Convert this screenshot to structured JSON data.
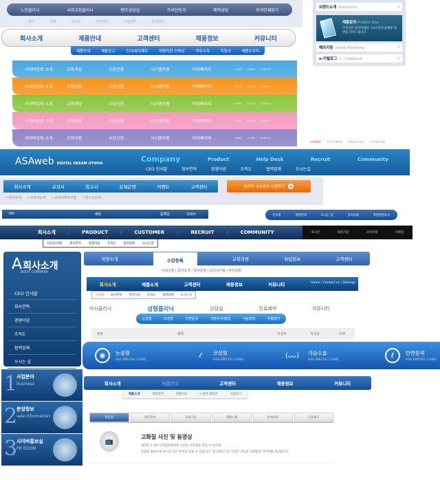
{
  "s1": {
    "top_nav": [
      "노인클리닉",
      "사회교정클리닉",
      "펜즈상담실",
      "프리던인과",
      "예약상담",
      "프리인재찾기"
    ],
    "sub_nav": [
      "회사",
      "위해",
      "파티재",
      "재미리시",
      "드림센터",
      "문제센터"
    ]
  },
  "right_box": {
    "brand": "브랜드소개",
    "brand_en": "Brand Intro",
    "qna": "제품문의",
    "qna_en": "Product Qna",
    "qna_text": "무엇이든 문의하세요. 24시간이내 빠른 답변을 약속드립니다.",
    "global": "해외지점",
    "global_en": "Global Marketing",
    "catalog": "e-카탈로그",
    "catalog_en": "e - Catalogue",
    "arrow": "›"
  },
  "s2": {
    "tabs": [
      "회사소개",
      "제품안내",
      "고객센터",
      "채용정보",
      "커뮤니티"
    ],
    "sub": [
      "제품안내",
      "채용공고",
      "인사/복지제도",
      "바람직한 인재상",
      "직무소개",
      "지원서",
      "채용도우미"
    ]
  },
  "color_bars": {
    "items": [
      "사이버강좌 소개",
      "교육과정",
      "수강신청",
      "시스템지원",
      "마이페이지"
    ],
    "small": [
      "HOME",
      "LOGIN",
      "SITEMAP"
    ],
    "colors": [
      "#4aa8e0",
      "#f7941d",
      "#8cc63f",
      "#f49ac1",
      "#8e86c9"
    ]
  },
  "langs": [
    "HOME",
    "SITEMAP",
    "ENGLISH",
    "CHINESE"
  ],
  "asaweb": {
    "logo": "ASAweb",
    "tagline": "DIGITAL DREAM UTOPIA",
    "main": [
      "Company",
      "Product",
      "Help Desk",
      "Recruit",
      "Community"
    ],
    "sub": [
      "CEO 인사말",
      "회사연혁",
      "경영이념",
      "조직도",
      "협력업체",
      "오시는길"
    ]
  },
  "panel": {
    "tabs": [
      "회사소개",
      "교과서",
      "참고서",
      "문제은행",
      "이벤트",
      "고객센터"
    ],
    "sub": [
      "• 회사소개",
      "• 교과서소개",
      "• 교과서제작과정",
      "• 연구소안내"
    ],
    "button": "온라인 수능강좌 신청하기"
  },
  "table1": {
    "headers": [
      "NO",
      "제목",
      "등록일",
      "조회수"
    ]
  },
  "pill1": [
    "인사말",
    "학원연혁",
    "오시는 길",
    "공지사항",
    "학원관련뉴스"
  ],
  "dark_bar": {
    "items": [
      "회사소개",
      "PRODUCT",
      "CUSTOMER",
      "RECRUIT",
      "COMMUNITY"
    ],
    "sep": "/",
    "util": [
      "로그인",
      "회원가입",
      "사이트맵",
      "이메일"
    ],
    "sub": [
      "CEO인사말",
      "회사연혁",
      "경영이념",
      "조직도",
      "협력업체",
      "오시는길"
    ]
  },
  "sidebar": {
    "title": "회사소개",
    "letter": "A",
    "subtitle": "BOUT COMPANY",
    "items": [
      "CEO 인사말",
      "회사연혁",
      "경영이념",
      "조직도",
      "협력업체",
      "오시는 길"
    ]
  },
  "tabs2": {
    "items": [
      "학원소개",
      "수강등록",
      "교육과정",
      "취업정보",
      "고객센터"
    ],
    "sub": "수강신청 | 강사소개 | 학사일정 | 강의시간표 | 추천강좌"
  },
  "bar3": {
    "items": [
      "회사소개",
      "제품소개",
      "고객센터",
      "채용정보",
      "커뮤니티"
    ],
    "links": "Home / Contact us / Sitemap",
    "sub": [
      "인사말",
      "회사연혁",
      "경영이념",
      "조직도",
      "협력업체",
      "오시는길"
    ]
  },
  "clinic": {
    "items": [
      "아사클리닉",
      "성형클리닉",
      "상담실",
      "진료예약",
      "커뮤니티"
    ],
    "pill": [
      "눈성형",
      "코성형",
      "안면윤곽",
      "지방이식/흡입",
      "가슴성형",
      "주름제거"
    ]
  },
  "table2": {
    "headers": [
      "번호",
      "제목",
      "작성자",
      "작성일",
      "조회"
    ]
  },
  "clinic_bar": {
    "items": [
      {
        "name": "눈성형",
        "sub": "ASA SPECIAL CLINIC"
      },
      {
        "name": "코성형",
        "sub": "ASA SPECIAL CLINIC"
      },
      {
        "name": "가슴수술",
        "sub": "ASA SPECIAL CLINIC"
      },
      {
        "name": "안면윤곽",
        "sub": "ASA SPECIAL CLINIC"
      }
    ]
  },
  "left_blocks": [
    {
      "num": "1",
      "title": "사업분야",
      "en": "business"
    },
    {
      "num": "2",
      "title": "분양정보",
      "en": "sale information"
    },
    {
      "num": "3",
      "title": "사이버홍보실",
      "en": "PR ROOM"
    }
  ],
  "nav4": {
    "items": [
      "회사소개",
      "제품안내",
      "고객센터",
      "채용정보",
      "커뮤니티"
    ],
    "sub": [
      "제품소개",
      "제품정책",
      "제품비교",
      "e-컴퍼 체험관",
      "사용후기"
    ]
  },
  "product_tabs": [
    "특장점",
    "세부정보",
    "주요기능",
    "제품스펙",
    "악세사리",
    "다운로드"
  ],
  "feature": {
    "title": "고화질 사진 및 동영상",
    "line1": "내장된 1.3M 디지털카메라로 나만의 사진첩을 만들 수 있으며,",
    "line2": "동영상 촬영으로 남기고 싶은 추억을 담을 수 있습니다. 업그레이드된 다양한 기능과 고화질의 이미지를 제공합니다."
  }
}
